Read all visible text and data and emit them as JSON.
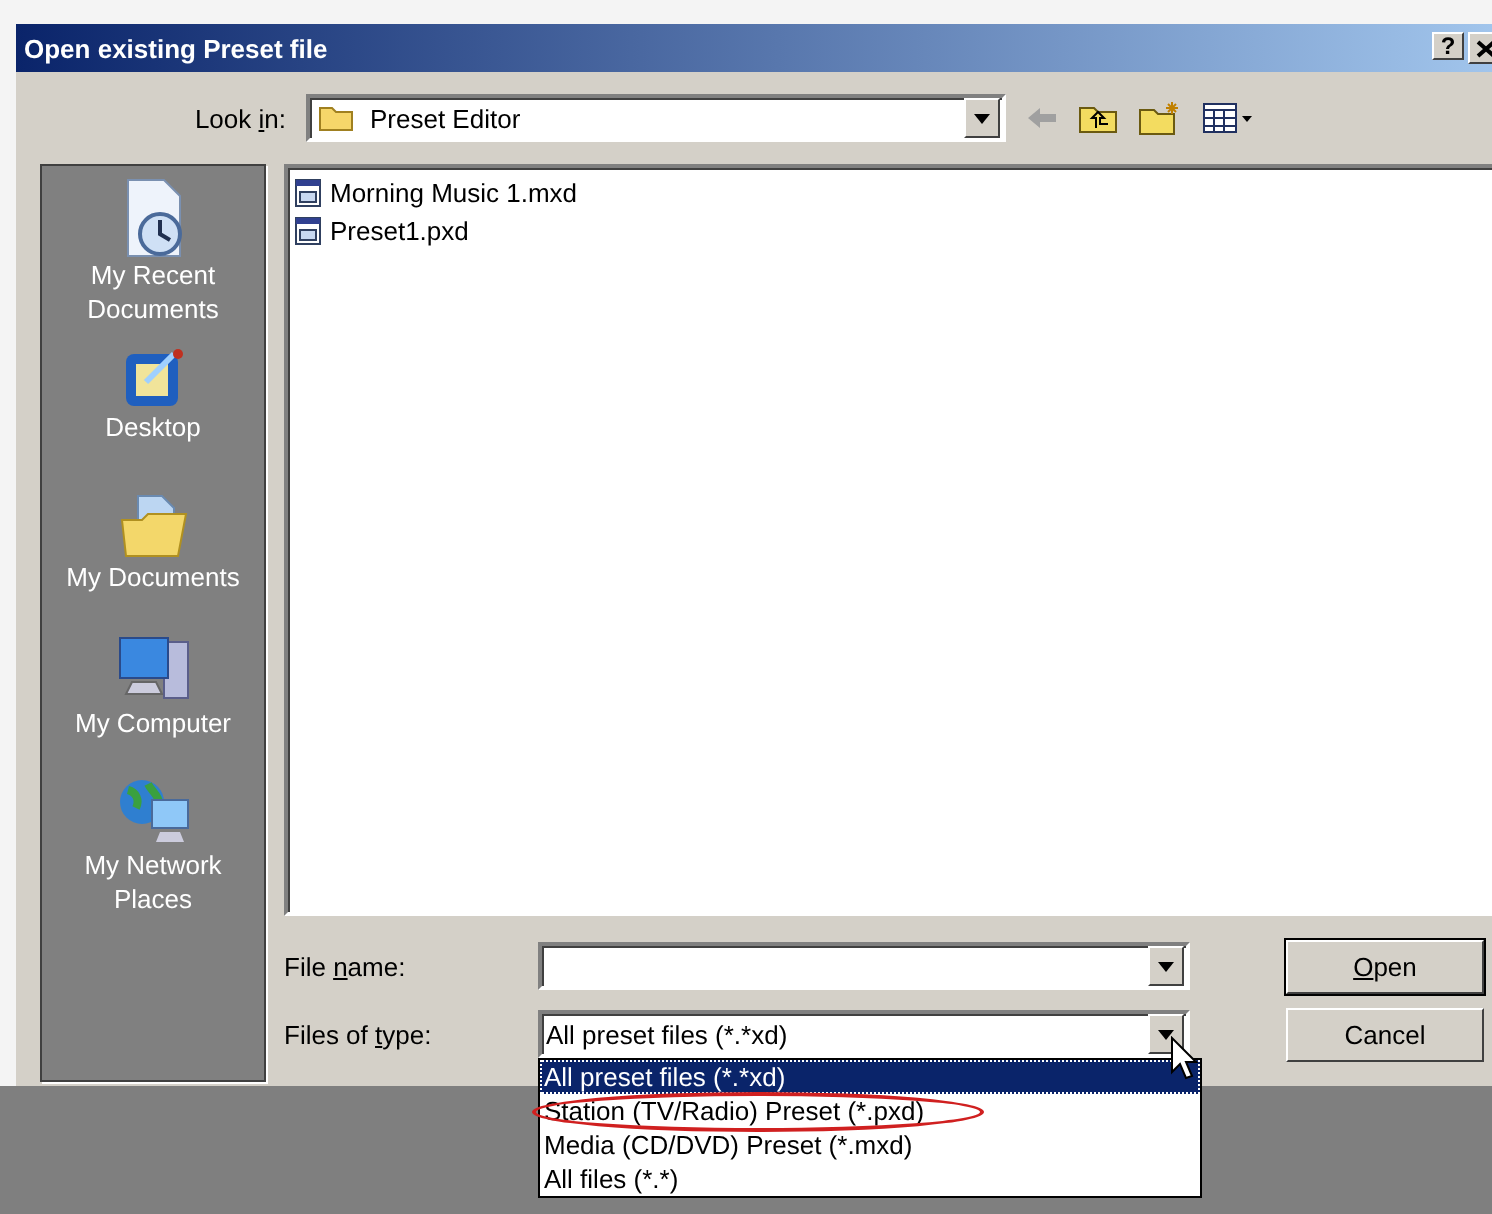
{
  "window": {
    "title": "Open existing Preset file",
    "help": "?"
  },
  "look_in": {
    "label": {
      "before": "Look ",
      "key": "i",
      "after": "n:"
    },
    "value": "Preset Editor"
  },
  "places": [
    {
      "kind": "recent",
      "label": "My Recent Documents"
    },
    {
      "kind": "desktop",
      "label": "Desktop"
    },
    {
      "kind": "documents",
      "label": "My Documents"
    },
    {
      "kind": "computer",
      "label": "My Computer"
    },
    {
      "kind": "network",
      "label": "My Network Places"
    }
  ],
  "files": [
    {
      "name": "Morning Music 1.mxd"
    },
    {
      "name": "Preset1.pxd"
    }
  ],
  "file_name": {
    "label": {
      "before": "File ",
      "key": "n",
      "after": "ame:"
    }
  },
  "files_of_type": {
    "label": {
      "before": "Files of ",
      "key": "t",
      "after": "ype:"
    },
    "value": "All preset files (*.*xd)",
    "options": [
      {
        "label": "All preset files (*.*xd)",
        "selected": true,
        "circled": false
      },
      {
        "label": "Station (TV/Radio) Preset (*.pxd)",
        "selected": false,
        "circled": true
      },
      {
        "label": "Media (CD/DVD) Preset (*.mxd)",
        "selected": false,
        "circled": false
      },
      {
        "label": "All files (*.*)",
        "selected": false,
        "circled": false
      }
    ]
  },
  "buttons": [
    {
      "label": {
        "key": "O",
        "after": "pen"
      },
      "default": true
    },
    {
      "label": {
        "before": "Cancel"
      },
      "default": false
    }
  ]
}
